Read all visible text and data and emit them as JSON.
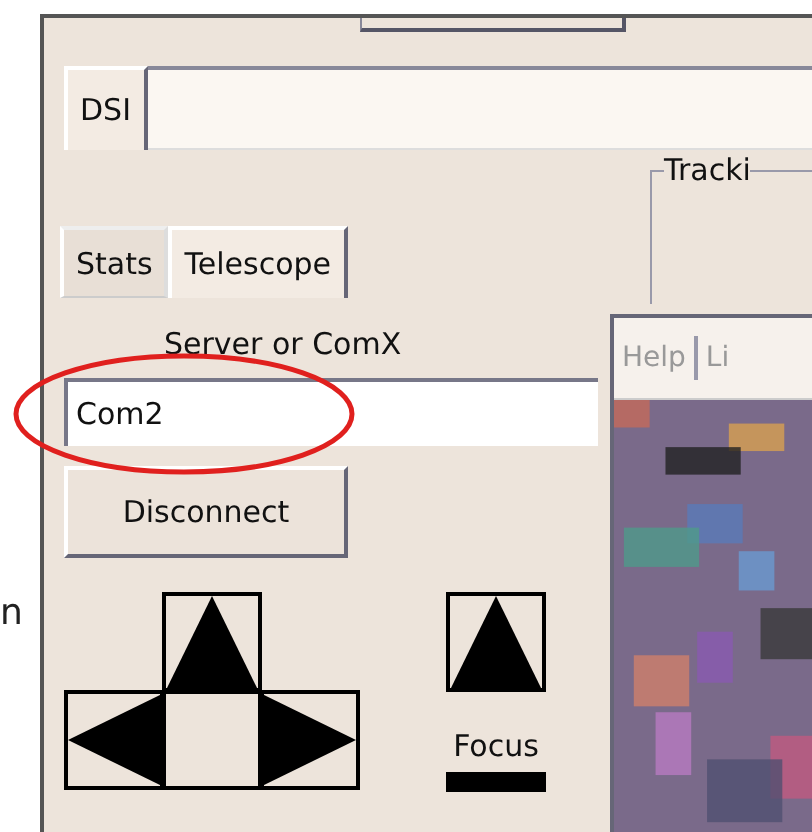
{
  "top_tabs": [
    {
      "label": "DSI",
      "selected": true
    }
  ],
  "tracking_group": {
    "title": "Tracki"
  },
  "panel_tabs": [
    {
      "label": "Stats",
      "selected": false
    },
    {
      "label": "Telescope",
      "selected": true
    }
  ],
  "server_label": "Server or ComX",
  "server_field": {
    "value": "Com2"
  },
  "disconnect_button": "Disconnect",
  "focus_label": "Focus",
  "viewer_menu": [
    "Help",
    "Li"
  ],
  "edge_text": "n"
}
